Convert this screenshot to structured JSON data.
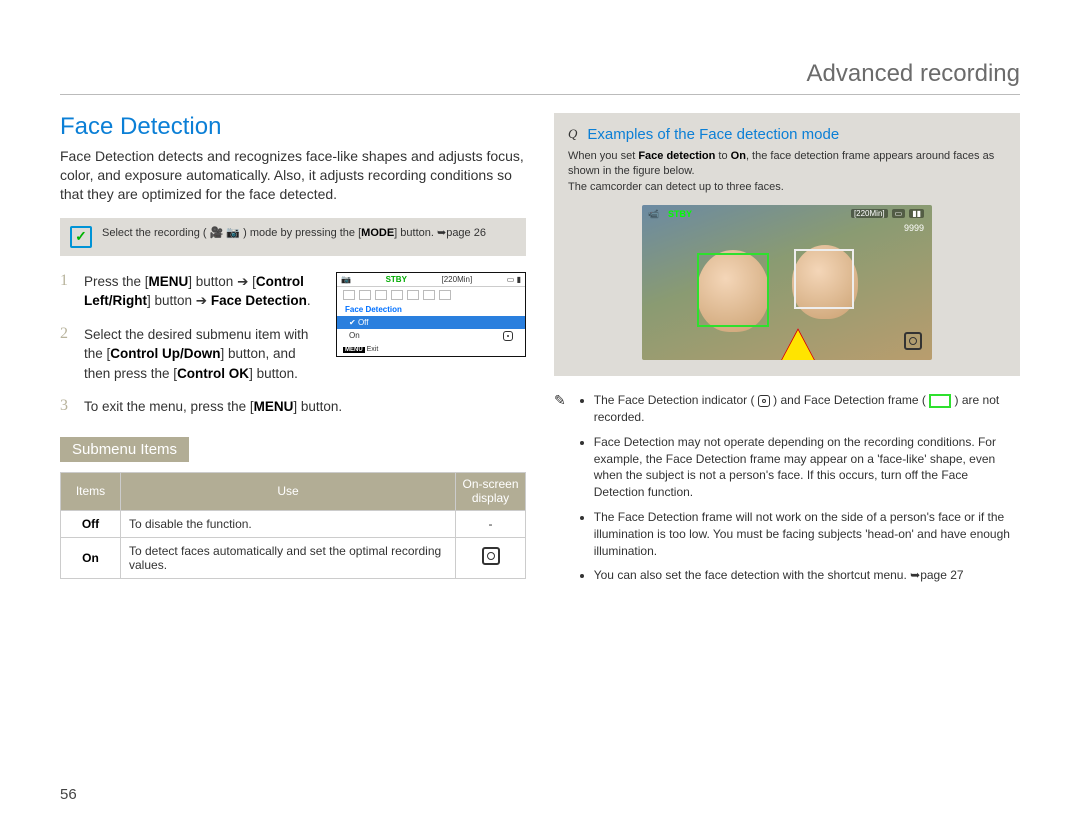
{
  "chapter": "Advanced recording",
  "page_number": "56",
  "section_title": "Face Detection",
  "intro": "Face Detection detects and recognizes face-like shapes and adjusts focus, color, and exposure automatically. Also, it adjusts recording conditions so that they are optimized for the face detected.",
  "mode_note": {
    "prefix": "Select the recording (",
    "suffix": ") mode by pressing the [",
    "button": "MODE",
    "tail": "] button. ➥page 26"
  },
  "steps": [
    {
      "n": "1",
      "html": "Press the [<b>MENU</b>] button ➔ [<b>Control Left/Right</b>] button ➔ <b>Face Detection</b>."
    },
    {
      "n": "2",
      "html": "Select the desired submenu item with the [<b>Control Up/Down</b>] button, and then press the [<b>Control OK</b>] button."
    },
    {
      "n": "3",
      "html": "To exit the menu, press the [<b>MENU</b>] button."
    }
  ],
  "menu_thumb": {
    "stby": "STBY",
    "time": "[220Min]",
    "label": "Face Detection",
    "row_off": "Off",
    "row_on": "On",
    "exit_btn": "MENU",
    "exit": "Exit"
  },
  "submenu_header": "Submenu Items",
  "table": {
    "head": [
      "Items",
      "Use",
      "On-screen display"
    ],
    "rows": [
      {
        "item": "Off",
        "use": "To disable the function.",
        "osd": "-"
      },
      {
        "item": "On",
        "use": "To detect faces automatically and set the optimal recording values.",
        "osd": "icon"
      }
    ]
  },
  "examples": {
    "title": "Examples of the Face detection mode",
    "body_pre": "When you set ",
    "body_b1": "Face detection",
    "body_mid": " to ",
    "body_b2": "On",
    "body_post": ", the face detection frame appears around faces as shown in the figure below.",
    "body_line2": "The camcorder can detect up to three faces.",
    "screen": {
      "stby": "STBY",
      "time": "[220Min]",
      "count": "9999"
    }
  },
  "notes": [
    "The Face Detection indicator ( ⌷ ) and Face Detection frame ( ▭ ) are not recorded.",
    "Face Detection may not operate depending on the recording conditions. For example, the Face Detection frame may appear on a 'face-like' shape, even when the subject is not a person's face. If this occurs, turn off the Face Detection function.",
    "The Face Detection frame will not work on the side of a person's face or if the illumination is too low. You must be facing subjects 'head-on' and have enough illumination.",
    "You can also set the face detection with the shortcut menu. ➥page 27"
  ]
}
